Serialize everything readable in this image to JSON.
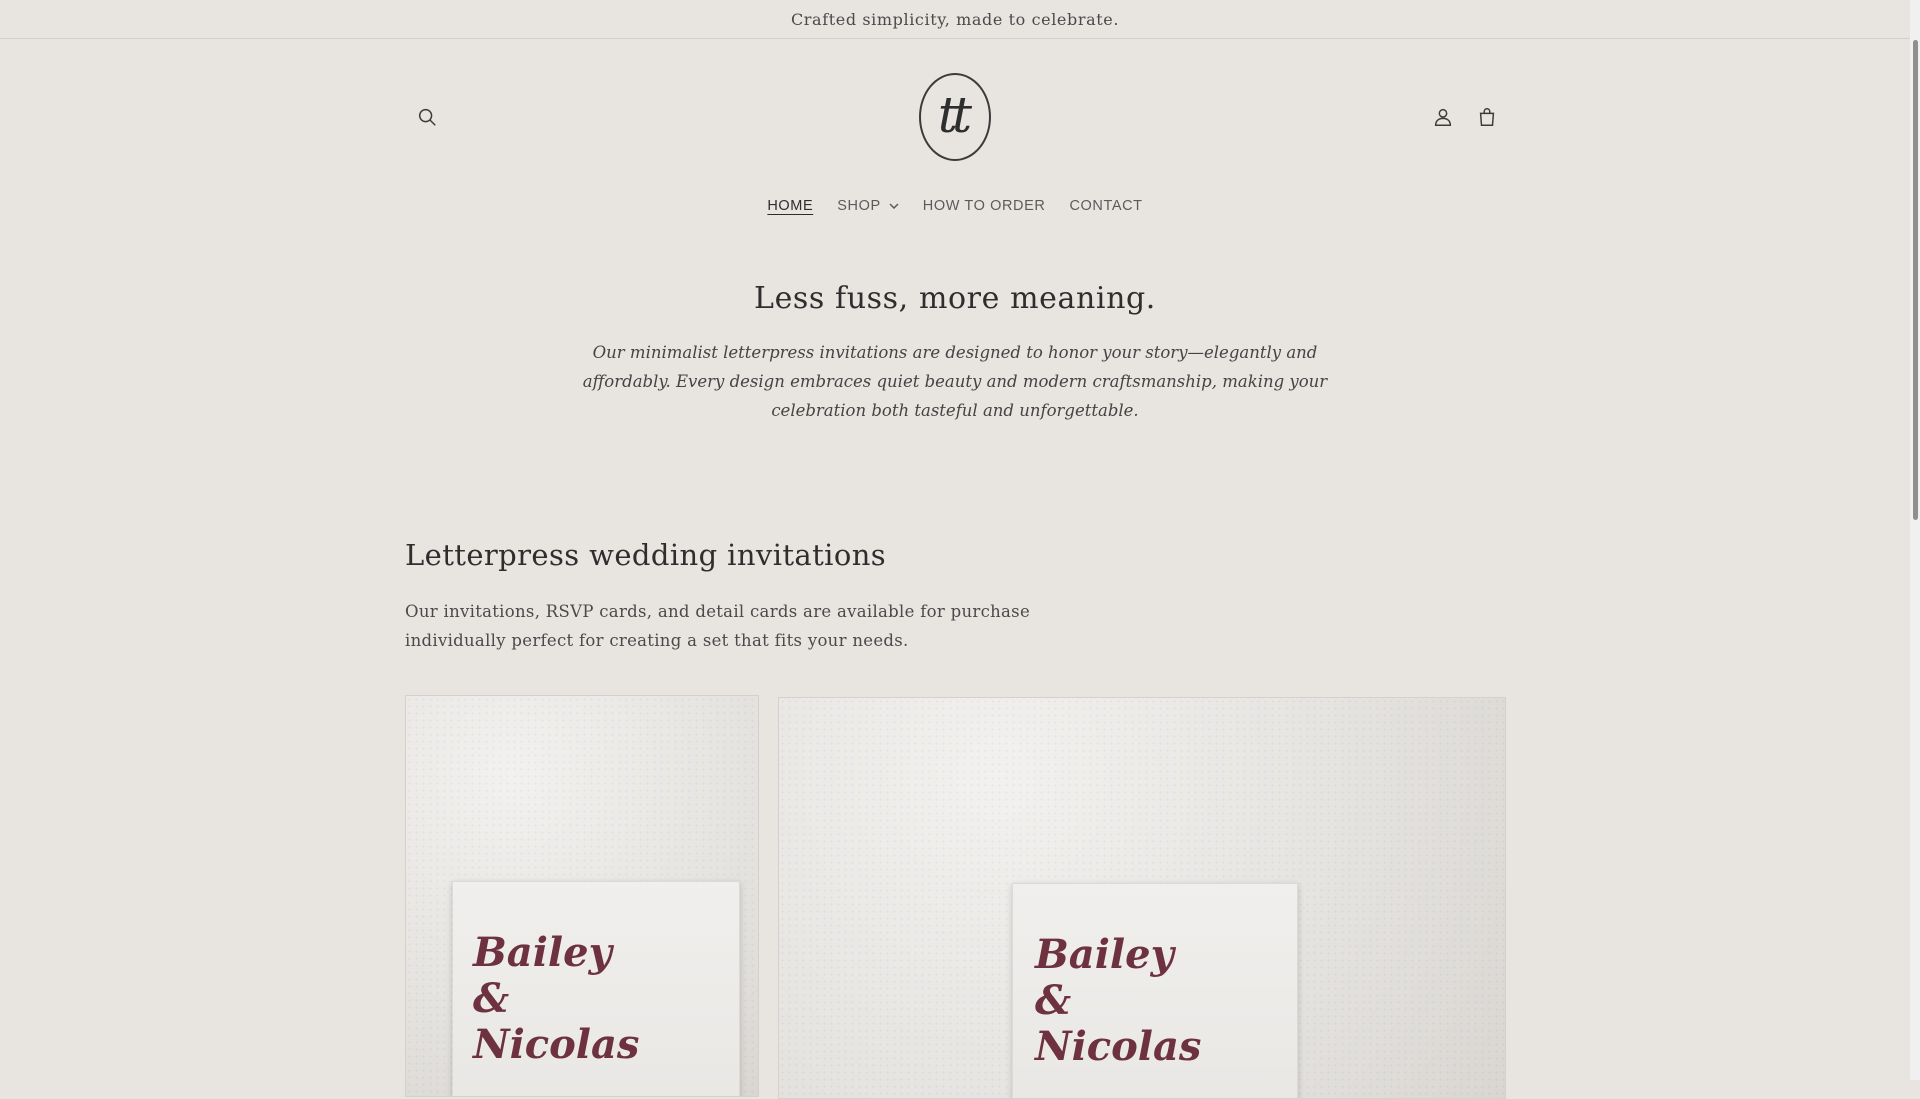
{
  "announcement": "Crafted simplicity, made to celebrate.",
  "logo_text": "tt",
  "header": {
    "search_icon": "search-icon",
    "account_icon": "account-icon",
    "cart_icon": "cart-icon"
  },
  "nav": {
    "home": "HOME",
    "shop": "SHOP",
    "how_to_order": "HOW TO ORDER",
    "contact": "CONTACT"
  },
  "hero": {
    "title": "Less fuss, more meaning.",
    "text": "Our minimalist letterpress invitations are designed to honor your story—elegantly and affordably. Every design embraces quiet beauty and modern craftsmanship, making your celebration both tasteful and unforgettable."
  },
  "section": {
    "title": "Letterpress wedding invitations",
    "text": "Our invitations, RSVP cards, and detail cards are available for purchase individually perfect for creating a set that fits your needs."
  },
  "cards": [
    {
      "invite_text": "Bailey\n&\nNicolas"
    },
    {
      "invite_text": "Bailey\n&\nNicolas"
    }
  ],
  "colors": {
    "background": "#e8e5e1",
    "text": "#3b3b3b",
    "invite_ink": "#6d3140"
  }
}
